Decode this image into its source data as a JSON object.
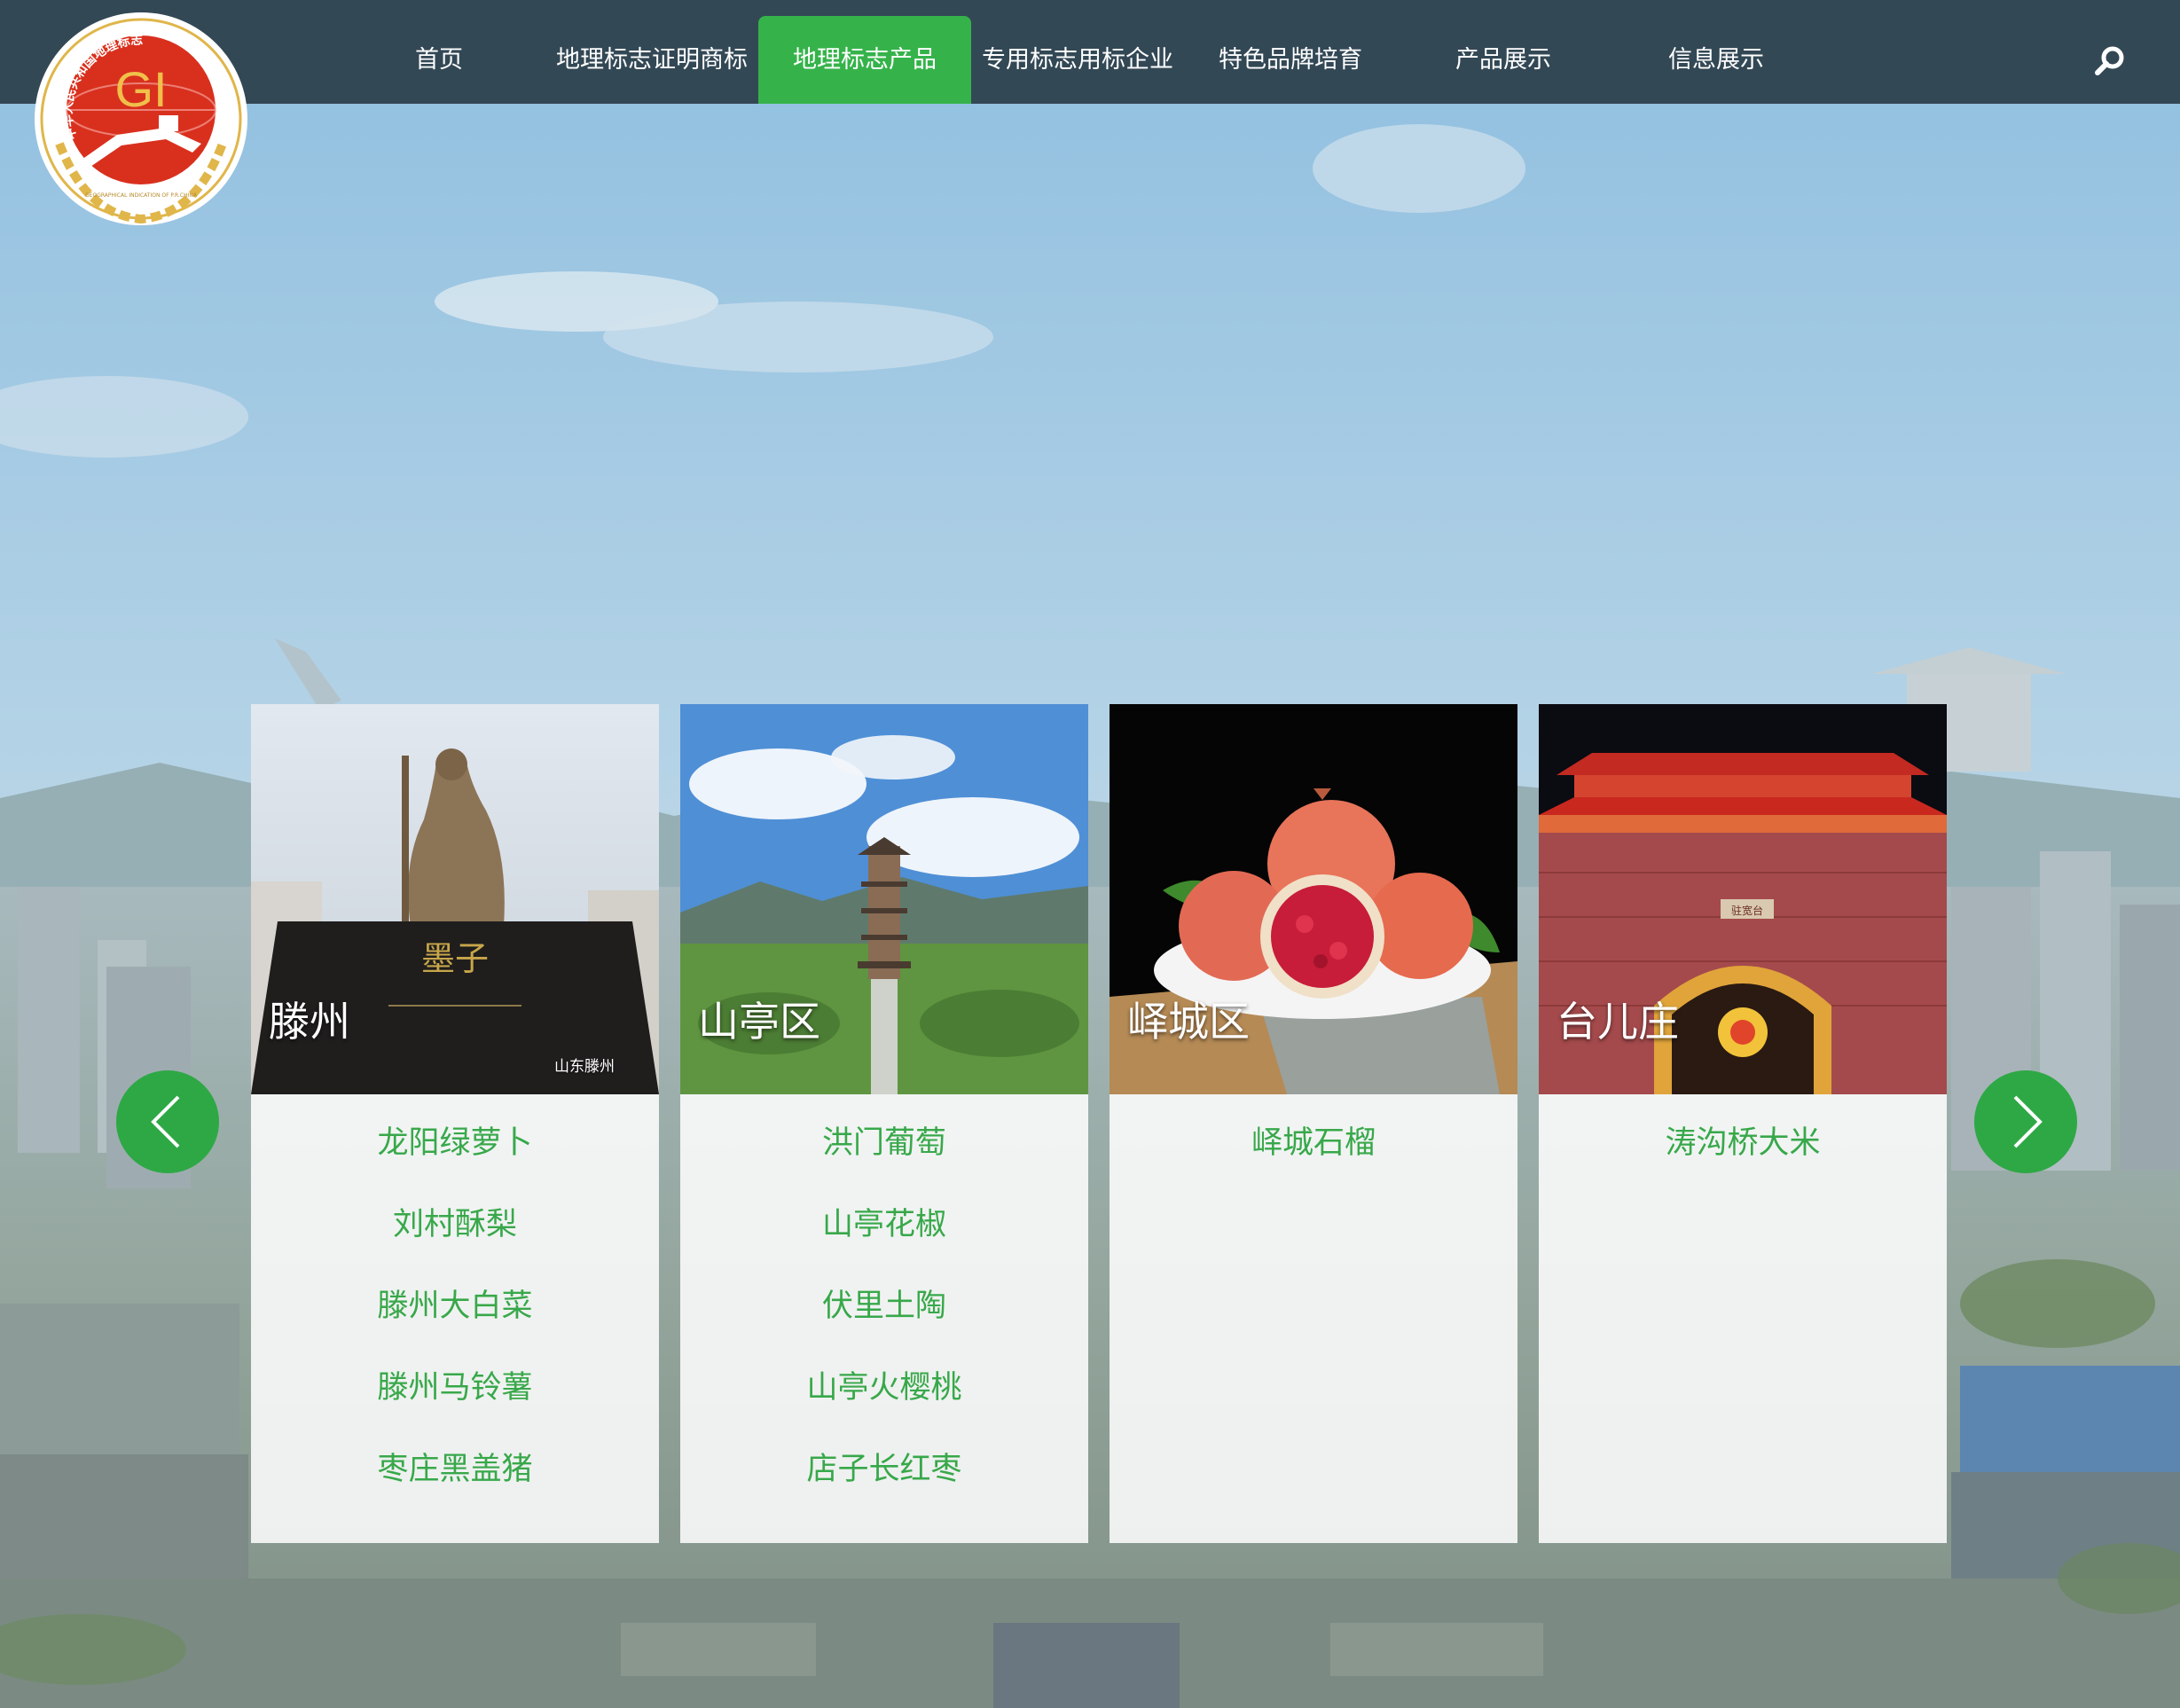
{
  "nav": {
    "items": [
      {
        "label": "首页"
      },
      {
        "label": "地理标志证明商标"
      },
      {
        "label": "地理标志产品"
      },
      {
        "label": "专用标志用标企业"
      },
      {
        "label": "特色品牌培育"
      },
      {
        "label": "产品展示"
      },
      {
        "label": "信息展示"
      }
    ],
    "active_index": 2,
    "search_icon": "search-icon"
  },
  "logo": {
    "letters": "GI",
    "ring_text": "中华人民共和国地理标志",
    "en_text": "GEOGRAPHICAL INDICATION OF P.R.CHINA"
  },
  "colors": {
    "nav_bg": "#2c3e4a",
    "accent_green": "#35b34a",
    "product_text": "#38a84a",
    "logo_red": "#d9301e",
    "logo_gold": "#e0b64a"
  },
  "carousel": {
    "prev_icon": "chevron-left-icon",
    "next_icon": "chevron-right-icon",
    "cards": [
      {
        "title": "滕州",
        "caption": "山东滕州",
        "sign_text": "墨子",
        "products": [
          "龙阳绿萝卜",
          "刘村酥梨",
          "滕州大白菜",
          "滕州马铃薯",
          "枣庄黑盖猪"
        ]
      },
      {
        "title": "山亭区",
        "products": [
          "洪门葡萄",
          "山亭花椒",
          "伏里土陶",
          "山亭火樱桃",
          "店子长红枣"
        ]
      },
      {
        "title": "峄城区",
        "products": [
          "峄城石榴"
        ]
      },
      {
        "title": "台儿庄",
        "gate_plaque": "驻宽台",
        "products": [
          "涛沟桥大米"
        ]
      }
    ]
  }
}
